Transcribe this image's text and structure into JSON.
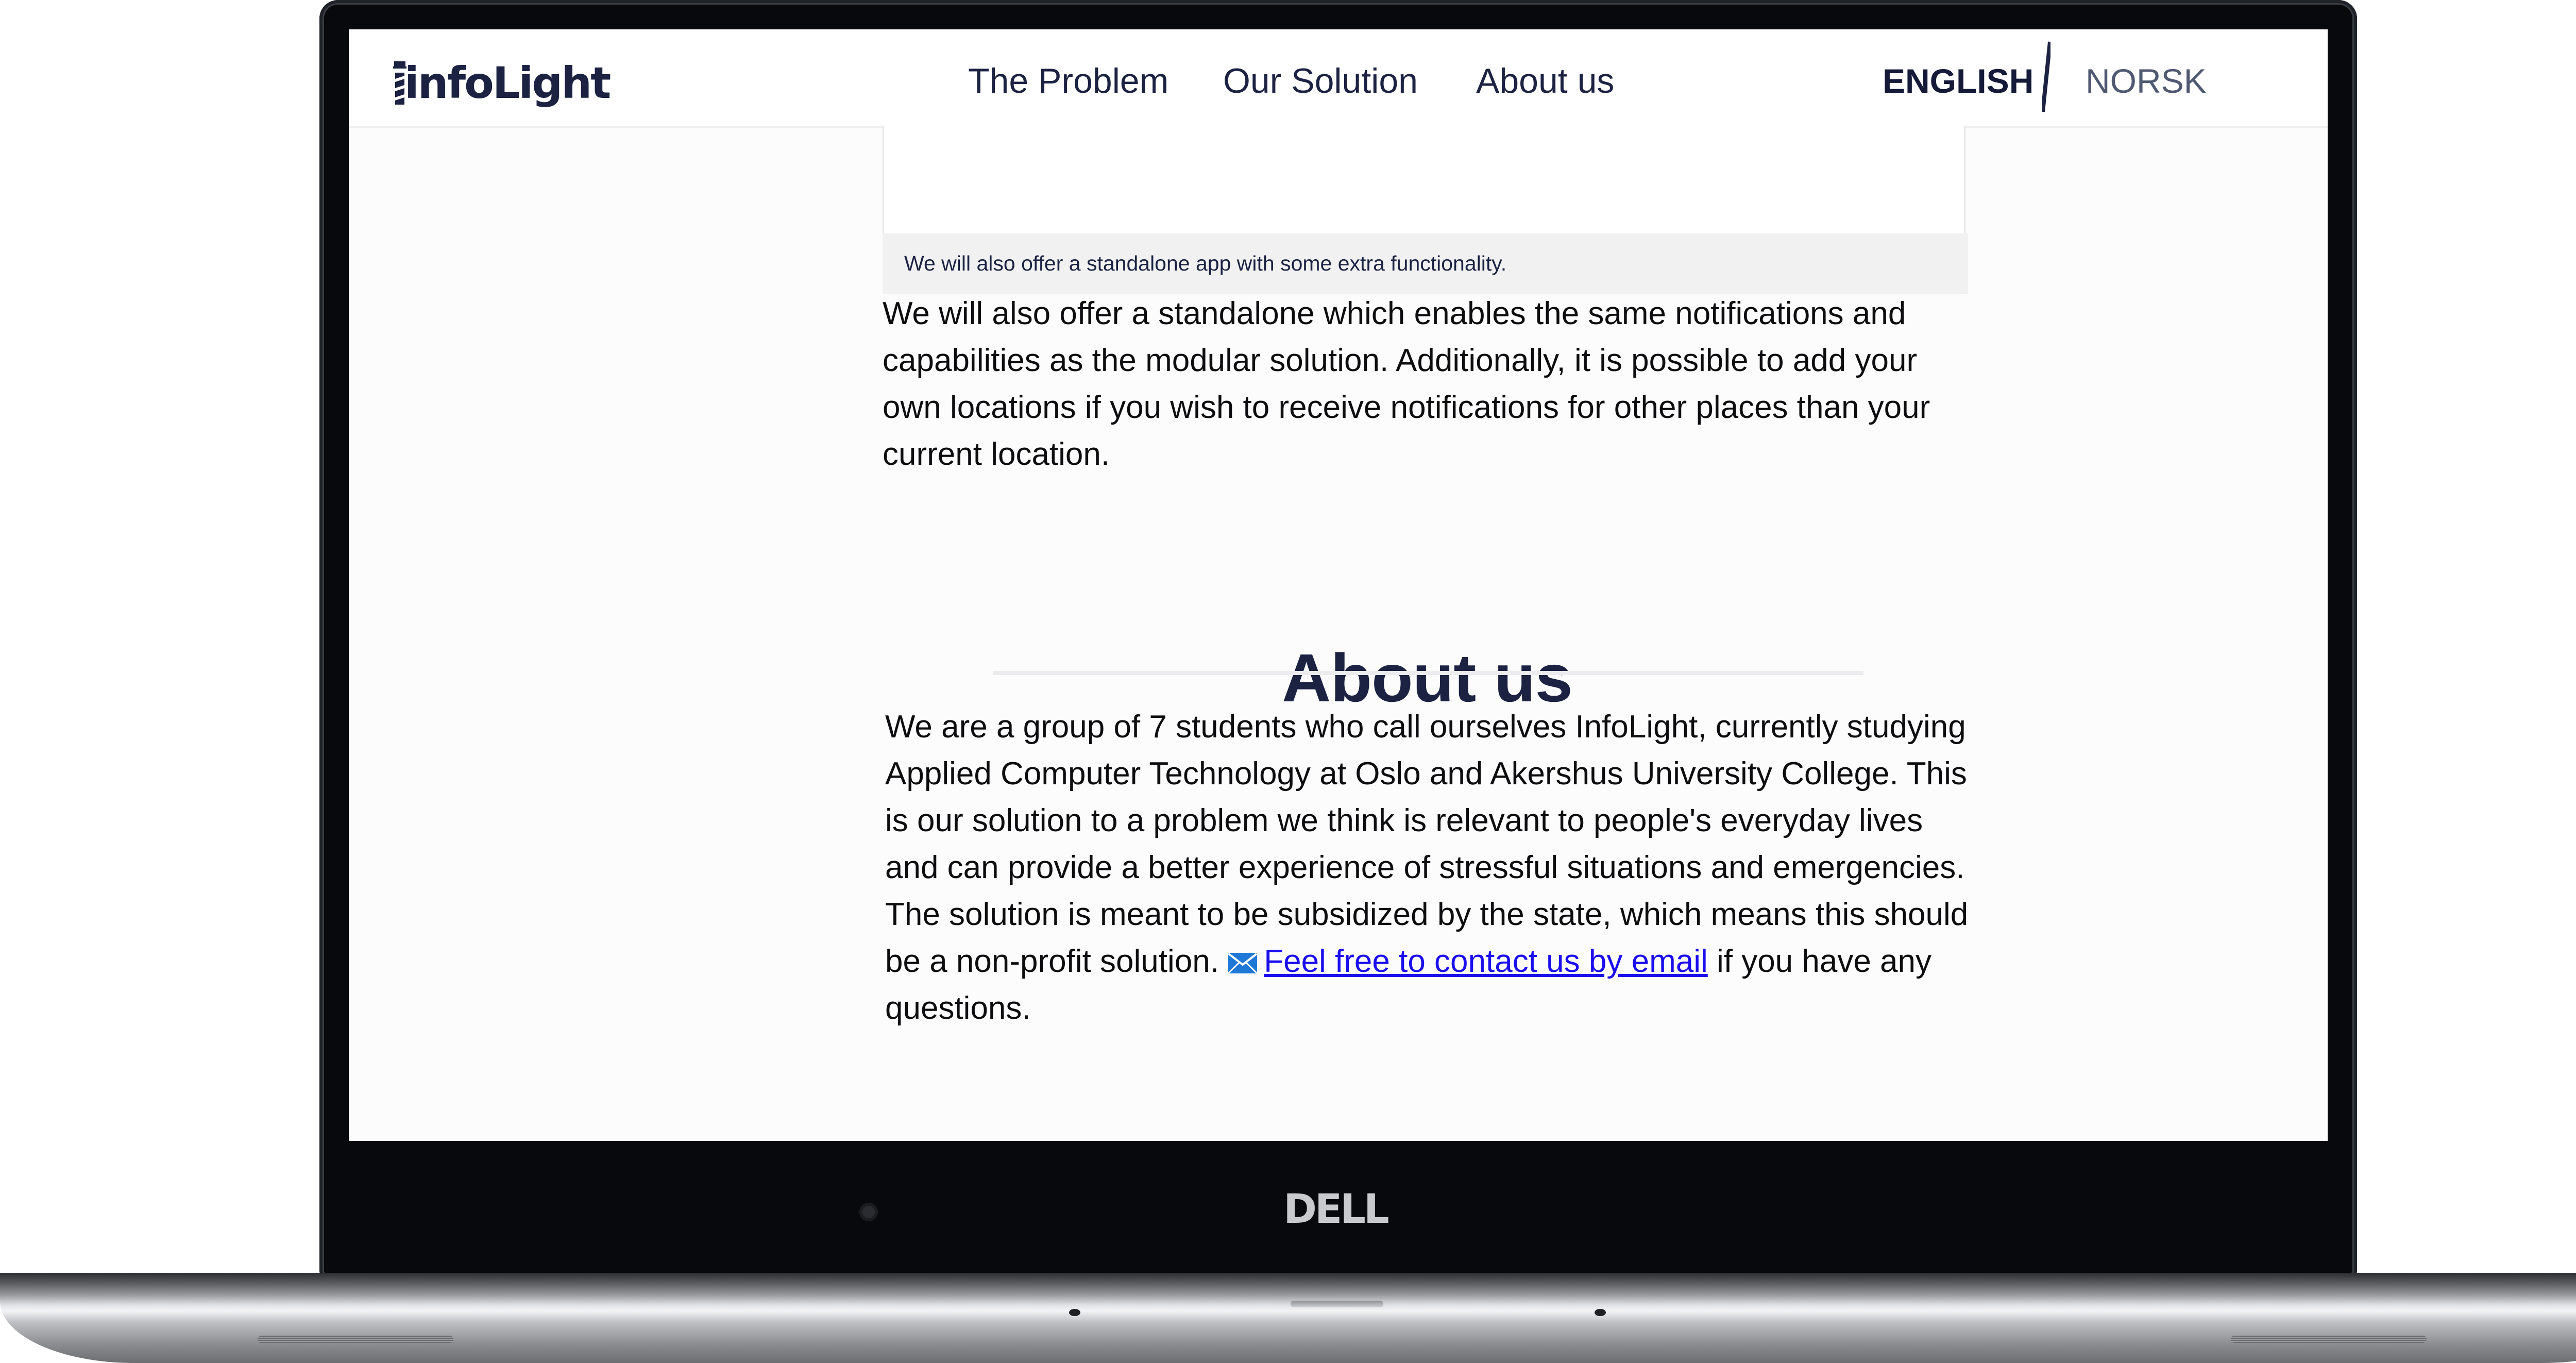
{
  "brand": {
    "logo_text": "infoLight"
  },
  "nav": {
    "items": [
      {
        "label": "The Problem"
      },
      {
        "label": "Our Solution"
      },
      {
        "label": "About us"
      }
    ]
  },
  "language": {
    "english": "ENGLISH",
    "norwegian": "NORSK",
    "active": "ENGLISH"
  },
  "figure": {
    "caption": "We will also offer a standalone app with some extra functionality."
  },
  "solution": {
    "paragraph": "We will also offer a standalone which enables the same notifications and capabilities as the modular solution. Additionally, it is possible to add your own locations if you wish to receive notifications for other places than your current location."
  },
  "about": {
    "heading": "About us",
    "paragraph_before_link": "We are a group of 7 students who call ourselves InfoLight, currently studying Applied Computer Technology at Oslo and Akershus University College. This is our solution to a problem we think is relevant to people's everyday lives and can provide a better experience of stressful situations and emergencies. The solution is meant to be subsidized by the state, which means this should be a non-profit solution.",
    "link_text": "Feel free to contact us by email",
    "paragraph_after_link": " if you have any questions.",
    "link_icon": "mail-icon"
  },
  "device": {
    "logo": "DELL",
    "logo_icon": "dell-logo"
  },
  "colors": {
    "navy": "#1b2242",
    "link": "#1a0dee",
    "mail_icon": "#1e78d6"
  }
}
